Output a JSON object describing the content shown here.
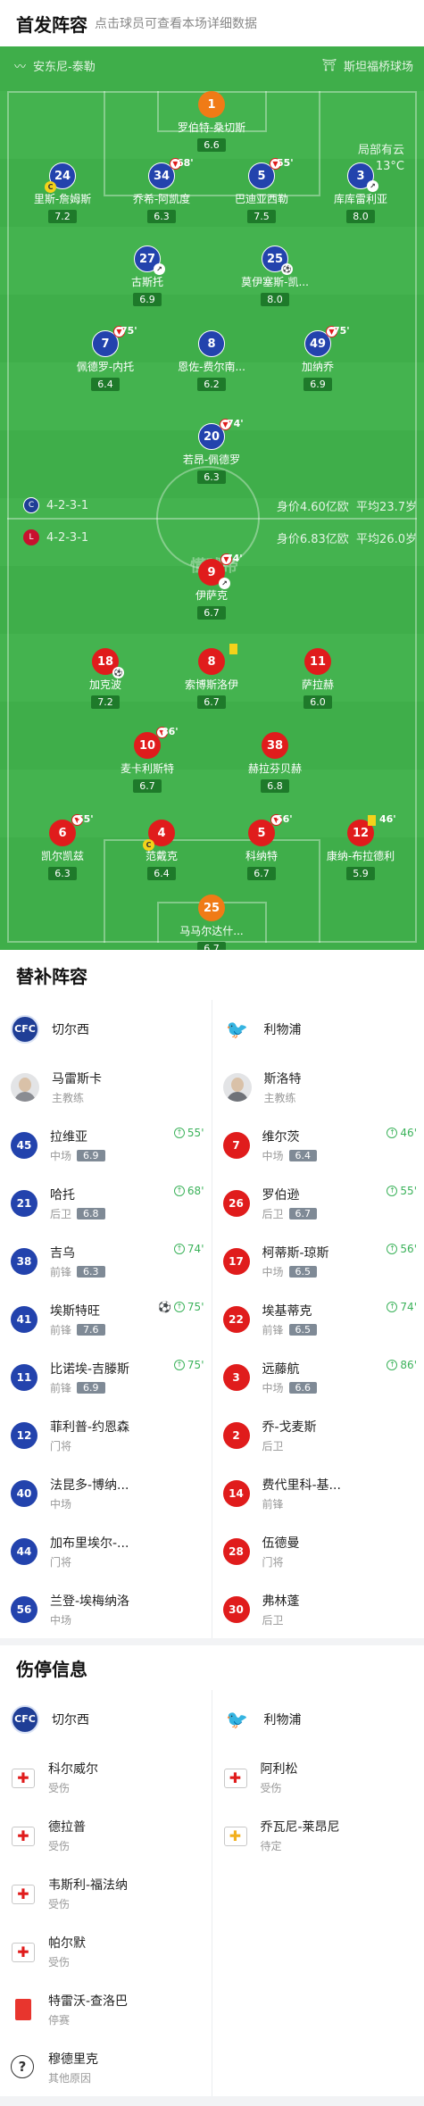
{
  "lineup": {
    "title": "首发阵容",
    "subtitle": "点击球员可查看本场详细数据"
  },
  "match": {
    "home_team": "安东尼-泰勒",
    "venue": "斯坦福桥球场",
    "weather": "局部有云",
    "temperature": "13°C",
    "center_logo": "懂球帝"
  },
  "home": {
    "formation": "4-2-3-1",
    "value": "身价4.60亿欧",
    "avg_age": "平均23.7岁",
    "players": [
      {
        "num": "1",
        "name": "罗伯特-桑切斯",
        "rating": "6.6"
      },
      {
        "num": "24",
        "name": "里斯-詹姆斯",
        "rating": "7.2"
      },
      {
        "num": "34",
        "name": "乔希-阿凯度",
        "rating": "6.3",
        "sub_min": "68'"
      },
      {
        "num": "5",
        "name": "巴迪亚西勒",
        "rating": "7.5",
        "sub_min": "55'"
      },
      {
        "num": "3",
        "name": "库库雷利亚",
        "rating": "8.0"
      },
      {
        "num": "27",
        "name": "古斯托",
        "rating": "6.9"
      },
      {
        "num": "25",
        "name": "莫伊塞斯-凯...",
        "rating": "8.0"
      },
      {
        "num": "7",
        "name": "佩德罗-内托",
        "rating": "6.4",
        "sub_min": "75'"
      },
      {
        "num": "8",
        "name": "恩佐-费尔南...",
        "rating": "6.2"
      },
      {
        "num": "49",
        "name": "加纳乔",
        "rating": "6.9",
        "sub_min": "75'"
      },
      {
        "num": "20",
        "name": "若昂-佩德罗",
        "rating": "6.3",
        "sub_min": "74'"
      }
    ]
  },
  "away": {
    "formation": "4-2-3-1",
    "value": "身价6.83亿欧",
    "avg_age": "平均26.0岁",
    "players": [
      {
        "num": "9",
        "name": "伊萨克",
        "rating": "6.7",
        "sub_min": "74'"
      },
      {
        "num": "18",
        "name": "加克波",
        "rating": "7.2"
      },
      {
        "num": "8",
        "name": "索博斯洛伊",
        "rating": "6.7"
      },
      {
        "num": "11",
        "name": "萨拉赫",
        "rating": "6.0"
      },
      {
        "num": "10",
        "name": "麦卡利斯特",
        "rating": "6.7",
        "sub_min": "86'"
      },
      {
        "num": "38",
        "name": "赫拉芬贝赫",
        "rating": "6.8"
      },
      {
        "num": "6",
        "name": "凯尔凯兹",
        "rating": "6.3",
        "sub_min": "55'"
      },
      {
        "num": "4",
        "name": "范戴克",
        "rating": "6.4"
      },
      {
        "num": "5",
        "name": "科纳特",
        "rating": "6.7",
        "sub_min": "56'"
      },
      {
        "num": "12",
        "name": "康纳-布拉德利",
        "rating": "5.9",
        "sub_min": "46'"
      },
      {
        "num": "25",
        "name": "马马尔达什...",
        "rating": "6.7"
      }
    ]
  },
  "subs": {
    "title": "替补阵容",
    "home_team": "切尔西",
    "away_team": "利物浦",
    "home_coach": {
      "name": "马雷斯卡",
      "role": "主教练"
    },
    "away_coach": {
      "name": "斯洛特",
      "role": "主教练"
    },
    "home": [
      {
        "num": "45",
        "name": "拉维亚",
        "pos": "中场",
        "rating": "6.9",
        "in": "55'"
      },
      {
        "num": "21",
        "name": "哈托",
        "pos": "后卫",
        "rating": "6.8",
        "in": "68'"
      },
      {
        "num": "38",
        "name": "吉乌",
        "pos": "前锋",
        "rating": "6.3",
        "in": "74'"
      },
      {
        "num": "41",
        "name": "埃斯特旺",
        "pos": "前锋",
        "rating": "7.6",
        "in": "75'",
        "goal": "⚽"
      },
      {
        "num": "11",
        "name": "比诺埃-吉滕斯",
        "pos": "前锋",
        "rating": "6.9",
        "in": "75'"
      },
      {
        "num": "12",
        "name": "菲利普-约恩森",
        "pos": "门将"
      },
      {
        "num": "40",
        "name": "法昆多-博纳...",
        "pos": "中场"
      },
      {
        "num": "44",
        "name": "加布里埃尔-...",
        "pos": "门将"
      },
      {
        "num": "56",
        "name": "兰登-埃梅纳洛",
        "pos": "中场"
      }
    ],
    "away": [
      {
        "num": "7",
        "name": "维尔茨",
        "pos": "中场",
        "rating": "6.4",
        "in": "46'"
      },
      {
        "num": "26",
        "name": "罗伯逊",
        "pos": "后卫",
        "rating": "6.7",
        "in": "55'"
      },
      {
        "num": "17",
        "name": "柯蒂斯-琼斯",
        "pos": "中场",
        "rating": "6.5",
        "in": "56'"
      },
      {
        "num": "22",
        "name": "埃基蒂克",
        "pos": "前锋",
        "rating": "6.5",
        "in": "74'"
      },
      {
        "num": "3",
        "name": "远藤航",
        "pos": "中场",
        "rating": "6.6",
        "in": "86'"
      },
      {
        "num": "2",
        "name": "乔-戈麦斯",
        "pos": "后卫"
      },
      {
        "num": "14",
        "name": "费代里科-基...",
        "pos": "前锋"
      },
      {
        "num": "28",
        "name": "伍德曼",
        "pos": "门将"
      },
      {
        "num": "30",
        "name": "弗林蓬",
        "pos": "后卫"
      }
    ]
  },
  "injuries": {
    "title": "伤停信息",
    "home_team": "切尔西",
    "away_team": "利物浦",
    "home": [
      {
        "name": "科尔威尔",
        "status": "受伤",
        "icon": "medical-kit-icon"
      },
      {
        "name": "德拉普",
        "status": "受伤",
        "icon": "medical-kit-icon"
      },
      {
        "name": "韦斯利-福法纳",
        "status": "受伤",
        "icon": "medical-kit-icon"
      },
      {
        "name": "帕尔默",
        "status": "受伤",
        "icon": "medical-kit-icon"
      },
      {
        "name": "特雷沃-查洛巴",
        "status": "停赛",
        "icon": "red-card-icon"
      },
      {
        "name": "穆德里克",
        "status": "其他原因",
        "icon": "question-icon"
      }
    ],
    "away": [
      {
        "name": "阿利松",
        "status": "受伤",
        "icon": "medical-kit-icon"
      },
      {
        "name": "乔瓦尼-莱昂尼",
        "status": "待定",
        "icon": "medical-kit-doubtful-icon"
      }
    ]
  },
  "colors": {
    "pitch": "#3fae4a",
    "home": "#2343ad",
    "away": "#e01c1c",
    "keeper": "#f07b16",
    "rating": "#1e7a2a"
  }
}
